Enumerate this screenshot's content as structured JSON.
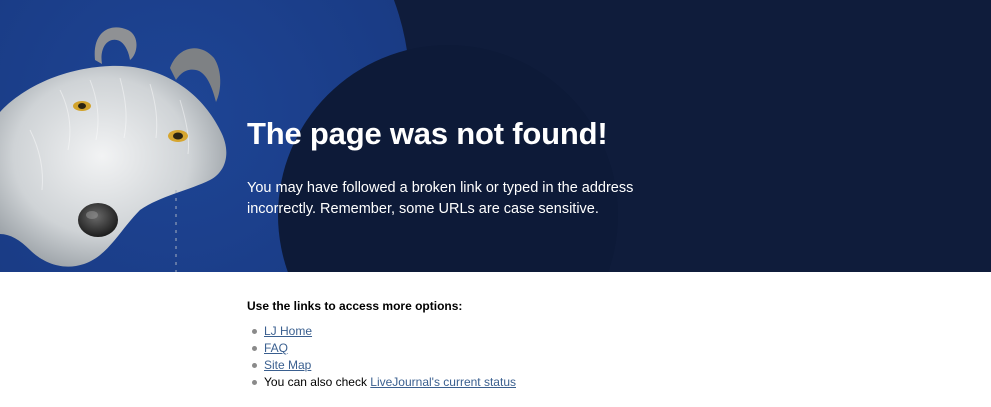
{
  "hero": {
    "title": "The page was not found!",
    "body_line1": "You may have followed a broken link or typed in the address",
    "body_line2": "incorrectly. Remember, some URLs are case sensitive.",
    "colors": {
      "background": "#0f1c3b",
      "circle_blue": "#1a3c86",
      "circle_dark": "#0d1a38"
    },
    "illustration": "goat-mascot"
  },
  "links": {
    "heading": "Use the links to access more options:",
    "items": [
      {
        "label": "LJ Home"
      },
      {
        "label": "FAQ"
      },
      {
        "label": "Site Map"
      }
    ],
    "status_prefix": "You can also check ",
    "status_link": "LiveJournal's current status",
    "link_color": "#3a5f8f"
  }
}
